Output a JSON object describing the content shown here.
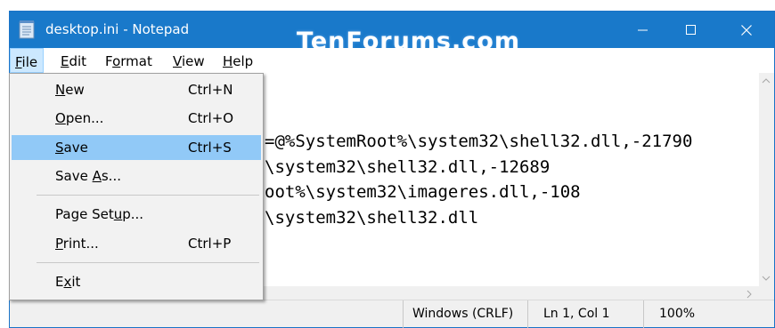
{
  "window": {
    "title": "desktop.ini - Notepad",
    "watermark": "TenForums.com",
    "controls": {
      "minimize": "—",
      "maximize": "☐",
      "close": "✕"
    }
  },
  "menubar": {
    "items": [
      {
        "label": "File",
        "mnemonic": "F",
        "rest": "ile"
      },
      {
        "label": "Edit",
        "mnemonic": "E",
        "rest": "dit"
      },
      {
        "label": "Format",
        "pre": "F",
        "mnemonic": "o",
        "rest": "rmat"
      },
      {
        "label": "View",
        "mnemonic": "V",
        "rest": "iew"
      },
      {
        "label": "Help",
        "mnemonic": "H",
        "rest": "elp"
      }
    ]
  },
  "file_menu": {
    "items": [
      {
        "pre": "",
        "mnemonic": "N",
        "rest": "ew",
        "shortcut": "Ctrl+N"
      },
      {
        "pre": "",
        "mnemonic": "O",
        "rest": "pen...",
        "shortcut": "Ctrl+O"
      },
      {
        "pre": "",
        "mnemonic": "S",
        "rest": "ave",
        "shortcut": "Ctrl+S"
      },
      {
        "pre": "Save ",
        "mnemonic": "A",
        "rest": "s...",
        "shortcut": ""
      },
      {
        "pre": "Page Set",
        "mnemonic": "u",
        "rest": "p...",
        "shortcut": ""
      },
      {
        "pre": "",
        "mnemonic": "P",
        "rest": "rint...",
        "shortcut": "Ctrl+P"
      },
      {
        "pre": "E",
        "mnemonic": "x",
        "rest": "it",
        "shortcut": ""
      }
    ],
    "hovered_item": "Save"
  },
  "editor": {
    "lines": [
      "=@%SystemRoot%\\system32\\shell32.dll,-21790",
      "\\system32\\shell32.dll,-12689",
      "oot%\\system32\\imageres.dll,-108",
      "\\system32\\shell32.dll"
    ]
  },
  "statusbar": {
    "line_ending": "Windows (CRLF)",
    "position": "Ln 1, Col 1",
    "zoom": "100%"
  },
  "colors": {
    "titlebar": "#1979ca",
    "menu_highlight": "#91c9f7",
    "menubar_active": "#cce8ff"
  },
  "icons": {
    "app": "notepad-icon",
    "scroll_up": "chevron-up-icon",
    "scroll_down": "chevron-down-icon",
    "scroll_right": "chevron-right-icon"
  }
}
